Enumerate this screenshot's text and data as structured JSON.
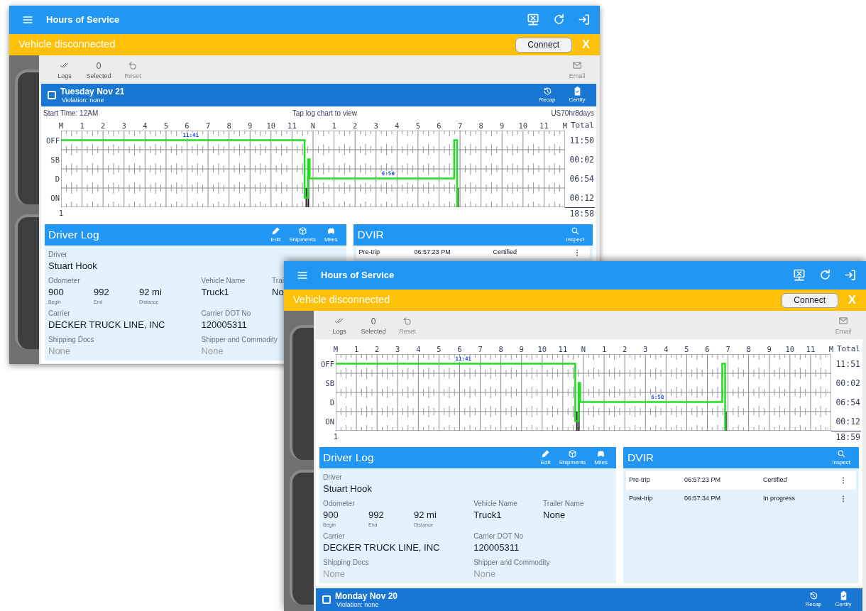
{
  "windows": [
    {
      "app_bar": {
        "title": "Hours of Service"
      },
      "banner": {
        "message": "Vehicle disconnected",
        "button": "Connect",
        "close": "X"
      },
      "toolbar": {
        "items": [
          {
            "kind": "logs",
            "label": "Logs",
            "disabled": false
          },
          {
            "kind": "selected",
            "value": "0",
            "label": "Selected",
            "disabled": false
          },
          {
            "kind": "reset",
            "label": "Reset",
            "disabled": true
          }
        ],
        "email": {
          "label": "Email",
          "disabled": true
        }
      },
      "day": {
        "title": "Tuesday Nov 21",
        "violation": "Violation: none",
        "checked": false,
        "actions": [
          {
            "kind": "recap",
            "label": "Recap"
          },
          {
            "kind": "certify",
            "label": "Certify"
          }
        ]
      },
      "chart": {
        "start_time": "Start Time: 12AM",
        "hint": "Tap log chart to view",
        "ruleset": "US70hr8days",
        "total_header": "Total",
        "hours": [
          "M",
          "1",
          "2",
          "3",
          "4",
          "5",
          "6",
          "7",
          "8",
          "9",
          "10",
          "11",
          "N",
          "1",
          "2",
          "3",
          "4",
          "5",
          "6",
          "7",
          "8",
          "9",
          "10",
          "11",
          "M"
        ],
        "statuses": [
          {
            "label": "OFF",
            "total": "11:50"
          },
          {
            "label": "SB",
            "total": "00:02"
          },
          {
            "label": "D",
            "total": "06:54"
          },
          {
            "label": "ON",
            "total": "00:12"
          }
        ],
        "grand_total": "18:58",
        "axis_start": "1",
        "segment_labels": [
          "11:41",
          "6:50"
        ]
      },
      "driver_log": {
        "title": "Driver Log",
        "actions": [
          {
            "kind": "edit",
            "label": "Edit"
          },
          {
            "kind": "shipments",
            "label": "Shipments"
          },
          {
            "kind": "miles",
            "label": "Miles"
          }
        ],
        "driver": {
          "label": "Driver",
          "value": "Stuart Hook"
        },
        "odometer": {
          "label": "Odometer",
          "readings": [
            {
              "value": "900",
              "caption": "Begin"
            },
            {
              "value": "992",
              "caption": "End"
            },
            {
              "value": "92 mi",
              "caption": "Distance"
            }
          ]
        },
        "vehicle": {
          "label": "Vehicle Name",
          "value": "Truck1"
        },
        "trailer": {
          "label": "Trai",
          "value": "No"
        },
        "carrier": {
          "label": "Carrier",
          "value": "DECKER TRUCK LINE, INC"
        },
        "carrier_dot": {
          "label": "Carrier DOT No",
          "value": "120005311"
        },
        "shipping_docs": {
          "label": "Shipping Docs",
          "value": "None",
          "empty": true
        },
        "shipper": {
          "label": "Shipper and Commodity",
          "value": "None",
          "empty": true
        }
      },
      "dvir": {
        "title": "DVIR",
        "action": "Inspect",
        "rows": [
          {
            "type": "Pre-trip",
            "time": "06:57:23 PM",
            "status": "Certified"
          }
        ]
      }
    },
    {
      "app_bar": {
        "title": "Hours of Service"
      },
      "banner": {
        "message": "Vehicle disconnected",
        "button": "Connect",
        "close": "X"
      },
      "toolbar": {
        "items": [
          {
            "kind": "logs",
            "label": "Logs",
            "disabled": false
          },
          {
            "kind": "selected",
            "value": "0",
            "label": "Selected",
            "disabled": false
          },
          {
            "kind": "reset",
            "label": "Reset",
            "disabled": true
          }
        ],
        "email": {
          "label": "Email",
          "disabled": true
        }
      },
      "chart": {
        "total_header": "Total",
        "hours": [
          "M",
          "1",
          "2",
          "3",
          "4",
          "5",
          "6",
          "7",
          "8",
          "9",
          "10",
          "11",
          "N",
          "1",
          "2",
          "3",
          "4",
          "5",
          "6",
          "7",
          "8",
          "9",
          "10",
          "11",
          "M"
        ],
        "statuses": [
          {
            "label": "OFF",
            "total": "11:51"
          },
          {
            "label": "SB",
            "total": "00:02"
          },
          {
            "label": "D",
            "total": "06:54"
          },
          {
            "label": "ON",
            "total": "00:12"
          }
        ],
        "grand_total": "18:59",
        "axis_start": "1",
        "segment_labels": [
          "11:41",
          "6:50"
        ]
      },
      "driver_log": {
        "title": "Driver Log",
        "actions": [
          {
            "kind": "edit",
            "label": "Edit"
          },
          {
            "kind": "shipments",
            "label": "Shipments"
          },
          {
            "kind": "miles",
            "label": "Miles"
          }
        ],
        "driver": {
          "label": "Driver",
          "value": "Stuart Hook"
        },
        "odometer": {
          "label": "Odometer",
          "readings": [
            {
              "value": "900",
              "caption": "Begin"
            },
            {
              "value": "992",
              "caption": "End"
            },
            {
              "value": "92 mi",
              "caption": "Distance"
            }
          ]
        },
        "vehicle": {
          "label": "Vehicle Name",
          "value": "Truck1"
        },
        "trailer": {
          "label": "Trailer Name",
          "value": "None"
        },
        "carrier": {
          "label": "Carrier",
          "value": "DECKER TRUCK LINE, INC"
        },
        "carrier_dot": {
          "label": "Carrier DOT No",
          "value": "120005311"
        },
        "shipping_docs": {
          "label": "Shipping Docs",
          "value": "None",
          "empty": true
        },
        "shipper": {
          "label": "Shipper and Commodity",
          "value": "None",
          "empty": true
        }
      },
      "dvir": {
        "title": "DVIR",
        "action": "Inspect",
        "rows": [
          {
            "type": "Pre-trip",
            "time": "06:57:23 PM",
            "status": "Certified"
          },
          {
            "type": "Post-trip",
            "time": "06:57:34 PM",
            "status": "In progress"
          }
        ]
      },
      "next_day": {
        "title": "Monday Nov 20",
        "violation": "Violation: none",
        "checked": false,
        "actions": [
          {
            "kind": "recap",
            "label": "Recap"
          },
          {
            "kind": "certify",
            "label": "Certify"
          }
        ]
      }
    }
  ]
}
